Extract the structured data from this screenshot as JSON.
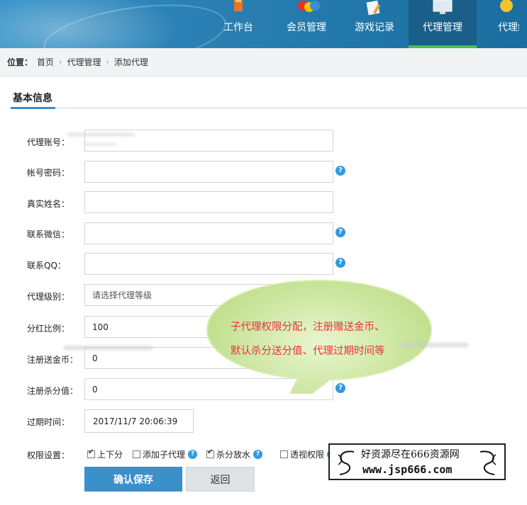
{
  "nav": {
    "items": [
      {
        "label": "工作台",
        "icon": "clipboard-icon"
      },
      {
        "label": "会员管理",
        "icon": "members-icon"
      },
      {
        "label": "游戏记录",
        "icon": "game-record-icon"
      },
      {
        "label": "代理管理",
        "icon": "monitor-icon",
        "active": true
      },
      {
        "label": "代理结",
        "icon": "coin-icon"
      }
    ]
  },
  "breadcrumb": {
    "prefix": "位置：",
    "items": [
      "首页",
      "代理管理",
      "添加代理"
    ],
    "separator": "›"
  },
  "section": {
    "title": "基本信息"
  },
  "form": {
    "account_label": "代理账号：",
    "password_label": "帐号密码：",
    "realname_label": "真实姓名：",
    "wechat_label": "联系微信：",
    "qq_label": "联系QQ：",
    "level_label": "代理级别：",
    "level_placeholder": "请选择代理等级",
    "ratio_label": "分红比例：",
    "ratio_value": "100",
    "gift_coins_label": "注册送金币：",
    "gift_coins_value": "0",
    "kill_score_label": "注册杀分值：",
    "kill_score_value": "0",
    "expire_label": "过期时间：",
    "expire_value": "2017/11/7 20:06:39",
    "perms_label": "权限设置：",
    "perms": [
      {
        "label": "上下分",
        "checked": true,
        "help": false
      },
      {
        "label": "添加子代理",
        "checked": false,
        "help": true
      },
      {
        "label": "杀分放水",
        "checked": true,
        "help": true
      },
      {
        "label": "透视权限",
        "checked": false,
        "help": true
      }
    ],
    "help_glyph": "?",
    "save_label": "确认保存",
    "back_label": "返回"
  },
  "callout": {
    "line1": "子代理权限分配，注册赠送金币、",
    "line2": "默认杀分送分值、代理过期时间等"
  },
  "watermark": {
    "title": "好资源尽在666资源网",
    "url": "www.jsp666.com"
  },
  "colors": {
    "header": "#2a7fb3",
    "active_tab": "#1a5f8a",
    "active_bar": "#45c05a",
    "primary_button": "#3b8fcb",
    "callout_fill": "#c7e59a",
    "callout_text": "#e8343b",
    "help_icon": "#2f9be0"
  }
}
